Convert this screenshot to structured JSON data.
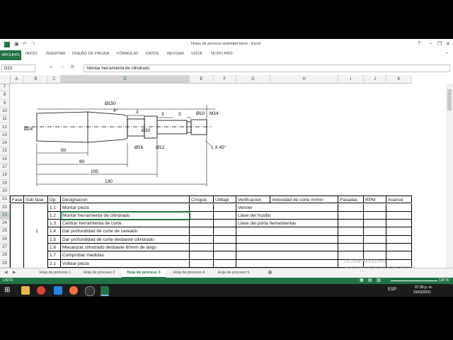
{
  "window": {
    "title": "Hojas de proceso actividad torno - Excel",
    "help": "?"
  },
  "ribbon": {
    "tabs": [
      "ARCHIVO",
      "INICIO",
      "INSERTAR",
      "DISEÑO DE PÁGINA",
      "FÓRMULAS",
      "DATOS",
      "REVISAR",
      "VISTA",
      "NITRO PRO"
    ]
  },
  "formula": {
    "namebox": "D23",
    "fx": "fx",
    "value": "Montar herramienta de cilindrado"
  },
  "columns": [
    "A",
    "B",
    "C",
    "D",
    "E",
    "F",
    "G",
    "H",
    "I",
    "J",
    "K"
  ],
  "rows": [
    "7",
    "8",
    "9",
    "10",
    "11",
    "12",
    "13",
    "14",
    "15",
    "16",
    "17",
    "18",
    "19",
    "20",
    "21",
    "22",
    "23",
    "24",
    "25",
    "26",
    "27",
    "28",
    "29"
  ],
  "drawing": {
    "dims": [
      "Ø150",
      "4°",
      "3",
      "3",
      "3",
      "Ø10",
      "M14",
      "Ø24",
      "Ø20",
      "Ø16",
      "Ø12",
      "1 X 45°",
      "50",
      "80",
      "105",
      "130"
    ]
  },
  "table": {
    "headers": [
      "Fase",
      "Sub fase",
      "Op",
      "Designacion",
      "Croquis",
      "Utillaje",
      "Verificacion",
      "Velocidad de corte m/min",
      "Pasadas",
      "RPM",
      "Avance"
    ],
    "subfase": "1",
    "rows": [
      {
        "op": "1.1",
        "desig": "Montar pieza",
        "verif": "Vernier"
      },
      {
        "op": "1.2",
        "desig": "Montar herramienta de cilindrado",
        "verif": "Llave del husillo"
      },
      {
        "op": "1.3",
        "desig": "Centrar herramienta de corte.",
        "verif": "Llave del porta herramientas"
      },
      {
        "op": "1.4",
        "desig": "Dar profundidad de corte de careado",
        "verif": ""
      },
      {
        "op": "1.5",
        "desig": "Dar profundidad de corte desbaste cilindrado",
        "verif": ""
      },
      {
        "op": "1.6",
        "desig": "Mecanizar cilindrado desbaste 60mm de largo",
        "verif": ""
      },
      {
        "op": "1.7",
        "desig": "Comprobar medidas",
        "verif": ""
      },
      {
        "op": "2.1",
        "desig": "Voltear pieza",
        "verif": ""
      }
    ]
  },
  "sheets": [
    "Hoja de proceso 1",
    "Hoja de proceso 2",
    "Hoja de proceso 3",
    "Hoja de proceso 4",
    "Hoja de proceso 5"
  ],
  "watermark": {
    "line1": "Activar Windows",
    "line2": "Ve a Configuración para activar Windows."
  },
  "status": {
    "ready": "LISTO",
    "zoom": "120 %"
  },
  "taskbar": {
    "lang": "ESP",
    "time": "07:36 p. m.",
    "date": "29/03/2021"
  }
}
